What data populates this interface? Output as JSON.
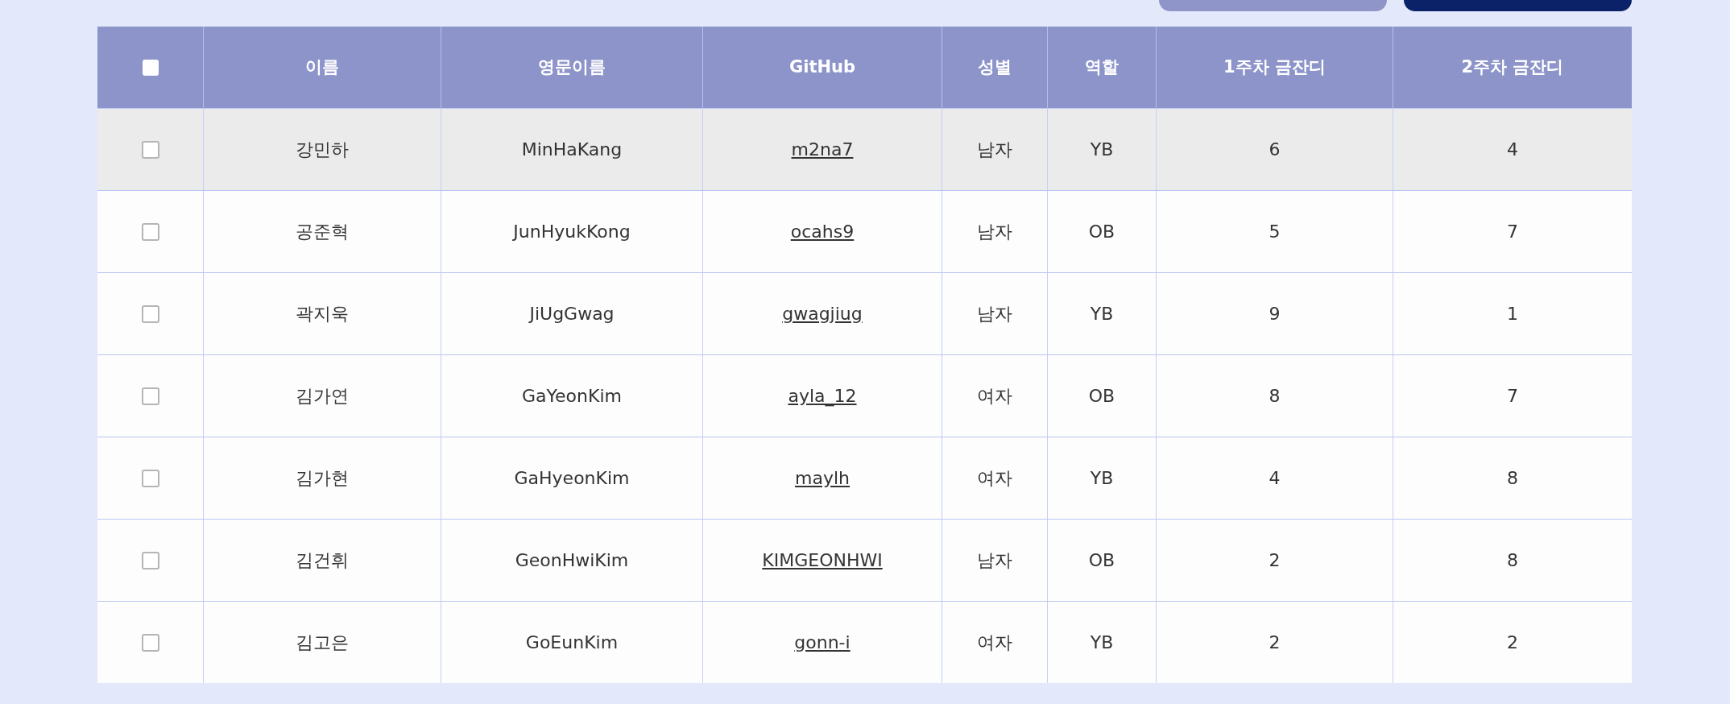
{
  "top_buttons": [
    {
      "kind": "secondary"
    },
    {
      "kind": "primary"
    }
  ],
  "table": {
    "select_all": {
      "checked": false
    },
    "columns": [
      "이름",
      "영문이름",
      "GitHub",
      "성별",
      "역할",
      "1주차 금잔디",
      "2주차 금잔디"
    ],
    "rows": [
      {
        "highlighted": true,
        "checked": false,
        "cells": [
          "강민하",
          "MinHaKang",
          "m2na7",
          "남자",
          "YB",
          "6",
          "4"
        ]
      },
      {
        "highlighted": false,
        "checked": false,
        "cells": [
          "공준혁",
          "JunHyukKong",
          "ocahs9",
          "남자",
          "OB",
          "5",
          "7"
        ]
      },
      {
        "highlighted": false,
        "checked": false,
        "cells": [
          "곽지욱",
          "JiUgGwag",
          "gwagjiug",
          "남자",
          "YB",
          "9",
          "1"
        ]
      },
      {
        "highlighted": false,
        "checked": false,
        "cells": [
          "김가연",
          "GaYeonKim",
          "ayla_12",
          "여자",
          "OB",
          "8",
          "7"
        ]
      },
      {
        "highlighted": false,
        "checked": false,
        "cells": [
          "김가현",
          "GaHyeonKim",
          "maylh",
          "여자",
          "YB",
          "4",
          "8"
        ]
      },
      {
        "highlighted": false,
        "checked": false,
        "cells": [
          "김건휘",
          "GeonHwiKim",
          "KIMGEONHWI",
          "남자",
          "OB",
          "2",
          "8"
        ]
      },
      {
        "highlighted": false,
        "checked": false,
        "cells": [
          "김고은",
          "GoEunKim",
          "gonn-i",
          "여자",
          "YB",
          "2",
          "2"
        ]
      }
    ]
  }
}
